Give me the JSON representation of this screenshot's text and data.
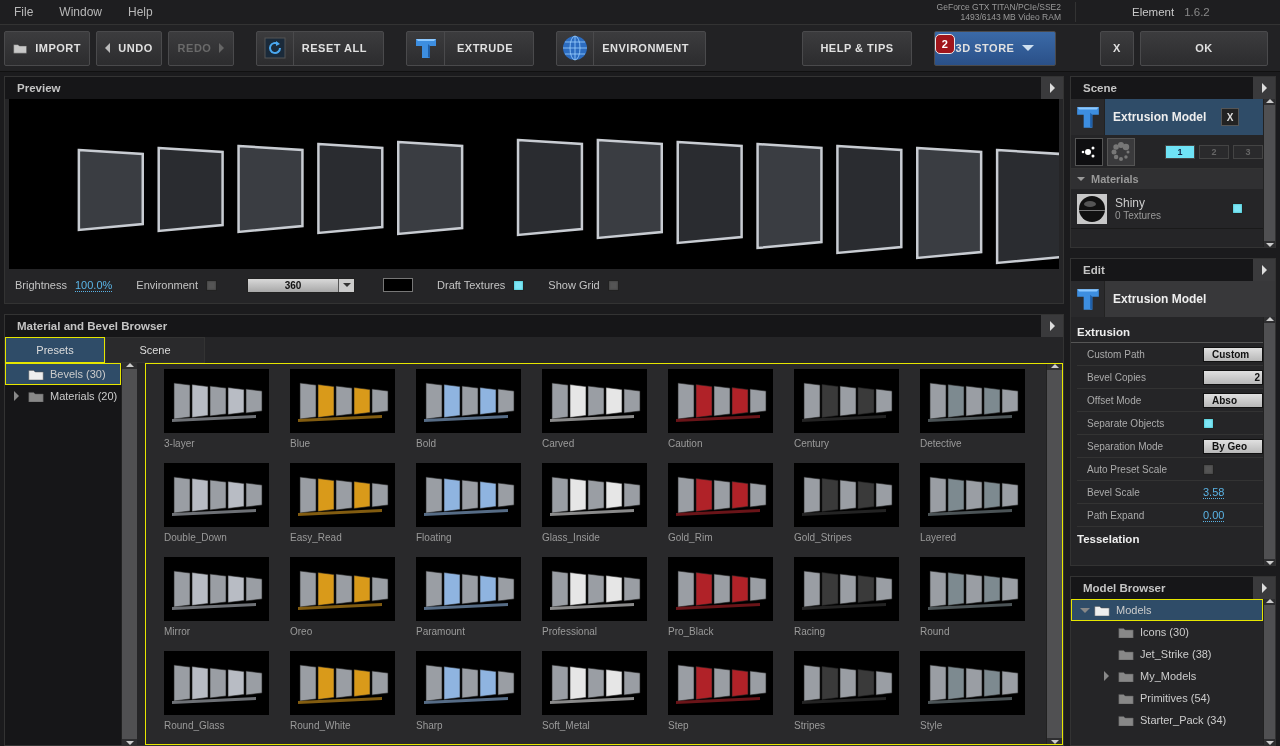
{
  "menu": [
    "File",
    "Window",
    "Help"
  ],
  "gpu": {
    "name": "GeForce GTX TITAN/PCIe/SSE2",
    "memory": "1493/6143 MB Video RAM"
  },
  "app": {
    "name": "Element",
    "version": "1.6.2"
  },
  "toolbar": [
    {
      "kind": "import",
      "label": "IMPORT",
      "disabled": false
    },
    {
      "kind": "undo",
      "label": "UNDO",
      "disabled": false
    },
    {
      "kind": "redo",
      "label": "REDO",
      "disabled": true
    },
    {
      "kind": "reset",
      "label": "RESET ALL",
      "disabled": false
    },
    {
      "kind": "extrude",
      "label": "EXTRUDE",
      "disabled": false
    },
    {
      "kind": "environment",
      "label": "ENVIRONMENT",
      "disabled": false
    },
    {
      "kind": "help",
      "label": "HELP & TIPS",
      "disabled": false
    },
    {
      "kind": "store",
      "label": "3D STORE",
      "badge": "2",
      "disabled": false
    },
    {
      "kind": "close",
      "label": "X",
      "disabled": false
    },
    {
      "kind": "ok",
      "label": "OK",
      "disabled": false
    }
  ],
  "preview": {
    "title": "Preview",
    "brightness_label": "Brightness",
    "brightness": "100.0%",
    "environment": {
      "label": "Environment",
      "checked": false
    },
    "env_map": "360",
    "draft_textures": {
      "label": "Draft Textures",
      "checked": true
    },
    "show_grid": {
      "label": "Show Grid",
      "checked": false
    }
  },
  "browser": {
    "title": "Material and Bevel Browser",
    "tabs": [
      {
        "label": "Presets",
        "selected": true
      },
      {
        "label": "Scene",
        "selected": false
      }
    ],
    "tree": [
      {
        "kind": "leaf",
        "label": "Bevels (30)",
        "selected": true
      },
      {
        "kind": "branch",
        "label": "Materials (20)",
        "selected": false,
        "expanded": false
      }
    ],
    "presets": [
      "3-layer",
      "Blue",
      "Bold",
      "Carved",
      "Caution",
      "Century",
      "Detective",
      "Double_Down",
      "Easy_Read",
      "Floating",
      "Glass_Inside",
      "Gold_Rim",
      "Gold_Stripes",
      "Layered",
      "Mirror",
      "Oreo",
      "Paramount",
      "Professional",
      "Pro_Black",
      "Racing",
      "Round",
      "Round_Glass",
      "Round_White",
      "Sharp",
      "Soft_Metal",
      "Step",
      "Stripes",
      "Style"
    ]
  },
  "scene": {
    "title": "Scene",
    "model": "Extrusion Model",
    "close": "X",
    "groups": [
      {
        "label": "1",
        "selected": true
      },
      {
        "label": "2",
        "selected": false
      },
      {
        "label": "3",
        "selected": false
      }
    ],
    "materials_header": "Materials",
    "materials_expanded": true,
    "materials": [
      {
        "name": "Shiny",
        "detail": "0 Textures",
        "checked": true
      }
    ]
  },
  "edit": {
    "title": "Edit",
    "model": "Extrusion Model",
    "section": "Extrusion",
    "rows": [
      {
        "kind": "dropdown",
        "label": "Custom Path",
        "value": "Custom"
      },
      {
        "kind": "field",
        "label": "Bevel Copies",
        "value": "2"
      },
      {
        "kind": "dropdown",
        "label": "Offset Mode",
        "value": "Abso"
      },
      {
        "kind": "checkbox",
        "label": "Separate Objects",
        "checked": true
      },
      {
        "kind": "dropdown",
        "label": "Separation Mode",
        "value": "By Geo"
      },
      {
        "kind": "checkbox",
        "label": "Auto Preset Scale",
        "checked": false
      },
      {
        "kind": "number",
        "label": "Bevel Scale",
        "value": "3.58"
      },
      {
        "kind": "number",
        "label": "Path Expand",
        "value": "0.00"
      }
    ],
    "next_section": "Tesselation"
  },
  "model_browser": {
    "title": "Model Browser",
    "tree": [
      {
        "kind": "branch",
        "label": "Models",
        "selected": true,
        "expanded": true,
        "children": [
          {
            "kind": "leaf",
            "label": "Icons (30)",
            "selected": false
          },
          {
            "kind": "leaf",
            "label": "Jet_Strike (38)",
            "selected": false
          },
          {
            "kind": "branch",
            "label": "My_Models",
            "selected": false,
            "expanded": false
          },
          {
            "kind": "leaf",
            "label": "Primitives (54)",
            "selected": false
          },
          {
            "kind": "leaf",
            "label": "Starter_Pack (34)",
            "selected": false
          }
        ]
      }
    ]
  }
}
